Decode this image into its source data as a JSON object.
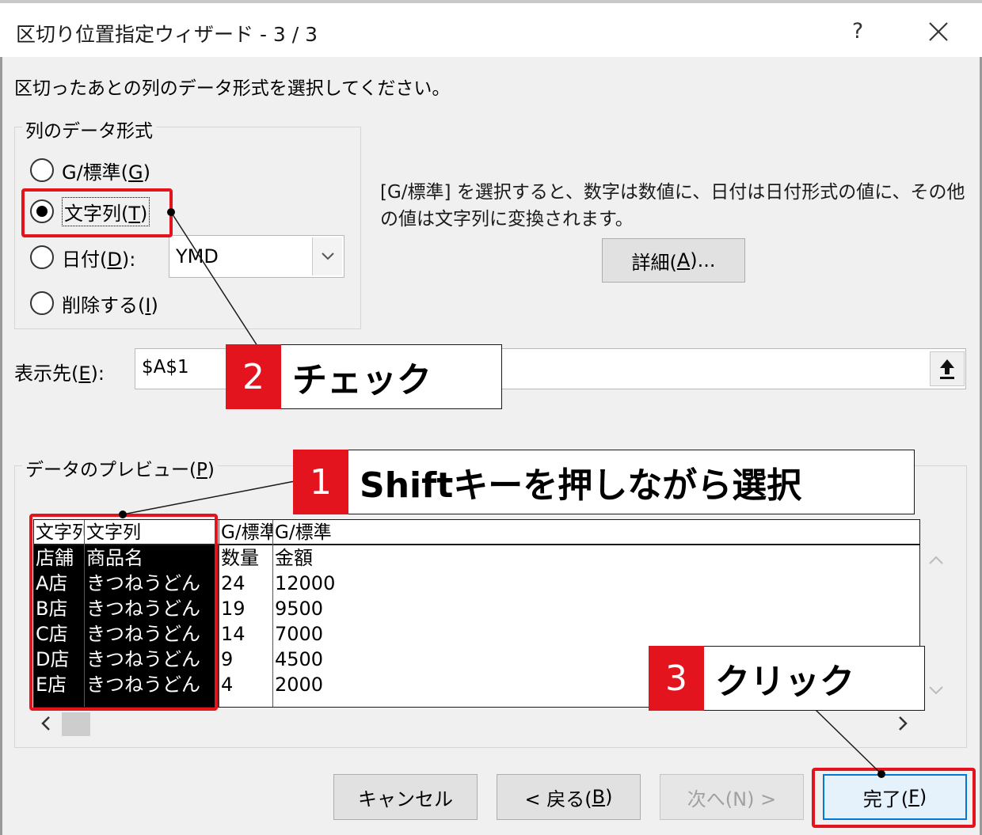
{
  "window": {
    "title": "区切り位置指定ウィザード - 3 / 3",
    "help_label": "?"
  },
  "instruction": "区切ったあとの列のデータ形式を選択してください。",
  "column_format": {
    "group_title": "列のデータ形式",
    "options": [
      {
        "label": "G/標準(",
        "mnemonic": "G",
        "suffix": ")",
        "checked": false
      },
      {
        "label": "文字列(",
        "mnemonic": "T",
        "suffix": ")",
        "checked": true
      },
      {
        "label": "日付(",
        "mnemonic": "D",
        "suffix": "):",
        "checked": false
      },
      {
        "label": "削除する(",
        "mnemonic": "I",
        "suffix": ")",
        "checked": false
      }
    ],
    "date_format_value": "YMD"
  },
  "description": "[G/標準] を選択すると、数字は数値に、日付は日付形式の値に、その他の値は文字列に変換されます。",
  "detail_button": {
    "label": "詳細(",
    "mnemonic": "A",
    "suffix": ")..."
  },
  "destination": {
    "label": "表示先(",
    "mnemonic": "E",
    "suffix": "):",
    "value": "$A$1"
  },
  "preview": {
    "title": "データのプレビュー(",
    "mnemonic": "P",
    "suffix": ")",
    "columns": [
      {
        "header": "文字列",
        "cells": [
          "店舗",
          "A店",
          "B店",
          "C店",
          "D店",
          "E店"
        ],
        "selected": true
      },
      {
        "header": "文字列",
        "cells": [
          "商品名",
          "きつねうどん",
          "きつねうどん",
          "きつねうどん",
          "きつねうどん",
          "きつねうどん"
        ],
        "selected": true
      },
      {
        "header": "G/標準",
        "cells": [
          "数量",
          "24",
          "19",
          "14",
          "9",
          "4"
        ],
        "selected": false
      },
      {
        "header": "G/標準",
        "cells": [
          "金額",
          "12000",
          "9500",
          "7000",
          "4500",
          "2000"
        ],
        "selected": false
      }
    ]
  },
  "footer": {
    "cancel": "キャンセル",
    "back": "< 戻る(",
    "back_mnemonic": "B",
    "back_suffix": ")",
    "next": "次へ(N) >",
    "finish": "完了(",
    "finish_mnemonic": "F",
    "finish_suffix": ")"
  },
  "annotations": {
    "step1": {
      "number": "1",
      "text": "Shiftキーを押しながら選択"
    },
    "step2": {
      "number": "2",
      "text": "チェック"
    },
    "step3": {
      "number": "3",
      "text": "クリック"
    },
    "accent_color": "#e4141e"
  }
}
